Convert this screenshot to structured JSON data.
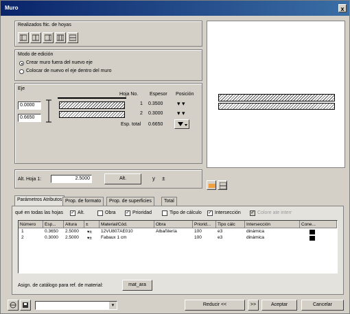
{
  "window": {
    "title": "Muro",
    "close": "x"
  },
  "toolbar_group": {
    "label": "Realizados ftic. de hoyas"
  },
  "edit_mode": {
    "label": "Modo de edición",
    "option1": "Crear muro fuera del nuevo eje",
    "option2": "Colocar de nuevo el eje dentro del muro"
  },
  "axis": {
    "label": "Eje",
    "top_value": "0.0000",
    "bottom_value": "0.6650",
    "col_layer": "Hoja No.",
    "col_thickness": "Espesor",
    "col_position": "Posición",
    "rows": [
      {
        "num": "1",
        "thickness": "0.3500"
      },
      {
        "num": "2",
        "thickness": "0.3000"
      }
    ],
    "total_label": "Esp. total",
    "total_value": "0.6650"
  },
  "height": {
    "label": "Alt. Hoja 1:",
    "value": "2.5000",
    "button": "Alt.",
    "extra": "y"
  },
  "tabs": [
    "Parámetros Atributos",
    "Prop. de formato",
    "Prop. de superficies",
    "Total"
  ],
  "filter_bar": {
    "lead": "qué en todas las hojas",
    "items": [
      "Alt.",
      "Obra",
      "Prioridad",
      "Tipo de cálculo",
      "Intersección",
      "Colore ate interr"
    ]
  },
  "table": {
    "headers": [
      "Número",
      "Esp...",
      "Altura",
      "Material/Cód.",
      "Obra",
      "Priorid...",
      "Tipo cálc",
      "Intersección",
      "Cone..."
    ],
    "rows": [
      [
        "1",
        "0.3650",
        "2.5000",
        "12VU807AE010",
        "Albañilería",
        "100",
        "e3",
        "dinámica"
      ],
      [
        "2",
        "0.3000",
        "2.5000",
        "Fabaux 1 cm",
        "",
        "100",
        "e3",
        "dinámica"
      ]
    ]
  },
  "catalog": {
    "label": "Asign. de catálogo para ref. de material:",
    "button": "mat_ara"
  },
  "footer": {
    "reduce": "Reducir <<",
    "forward": ">>",
    "accept": "Aceptar",
    "cancel": "Cancelar"
  }
}
